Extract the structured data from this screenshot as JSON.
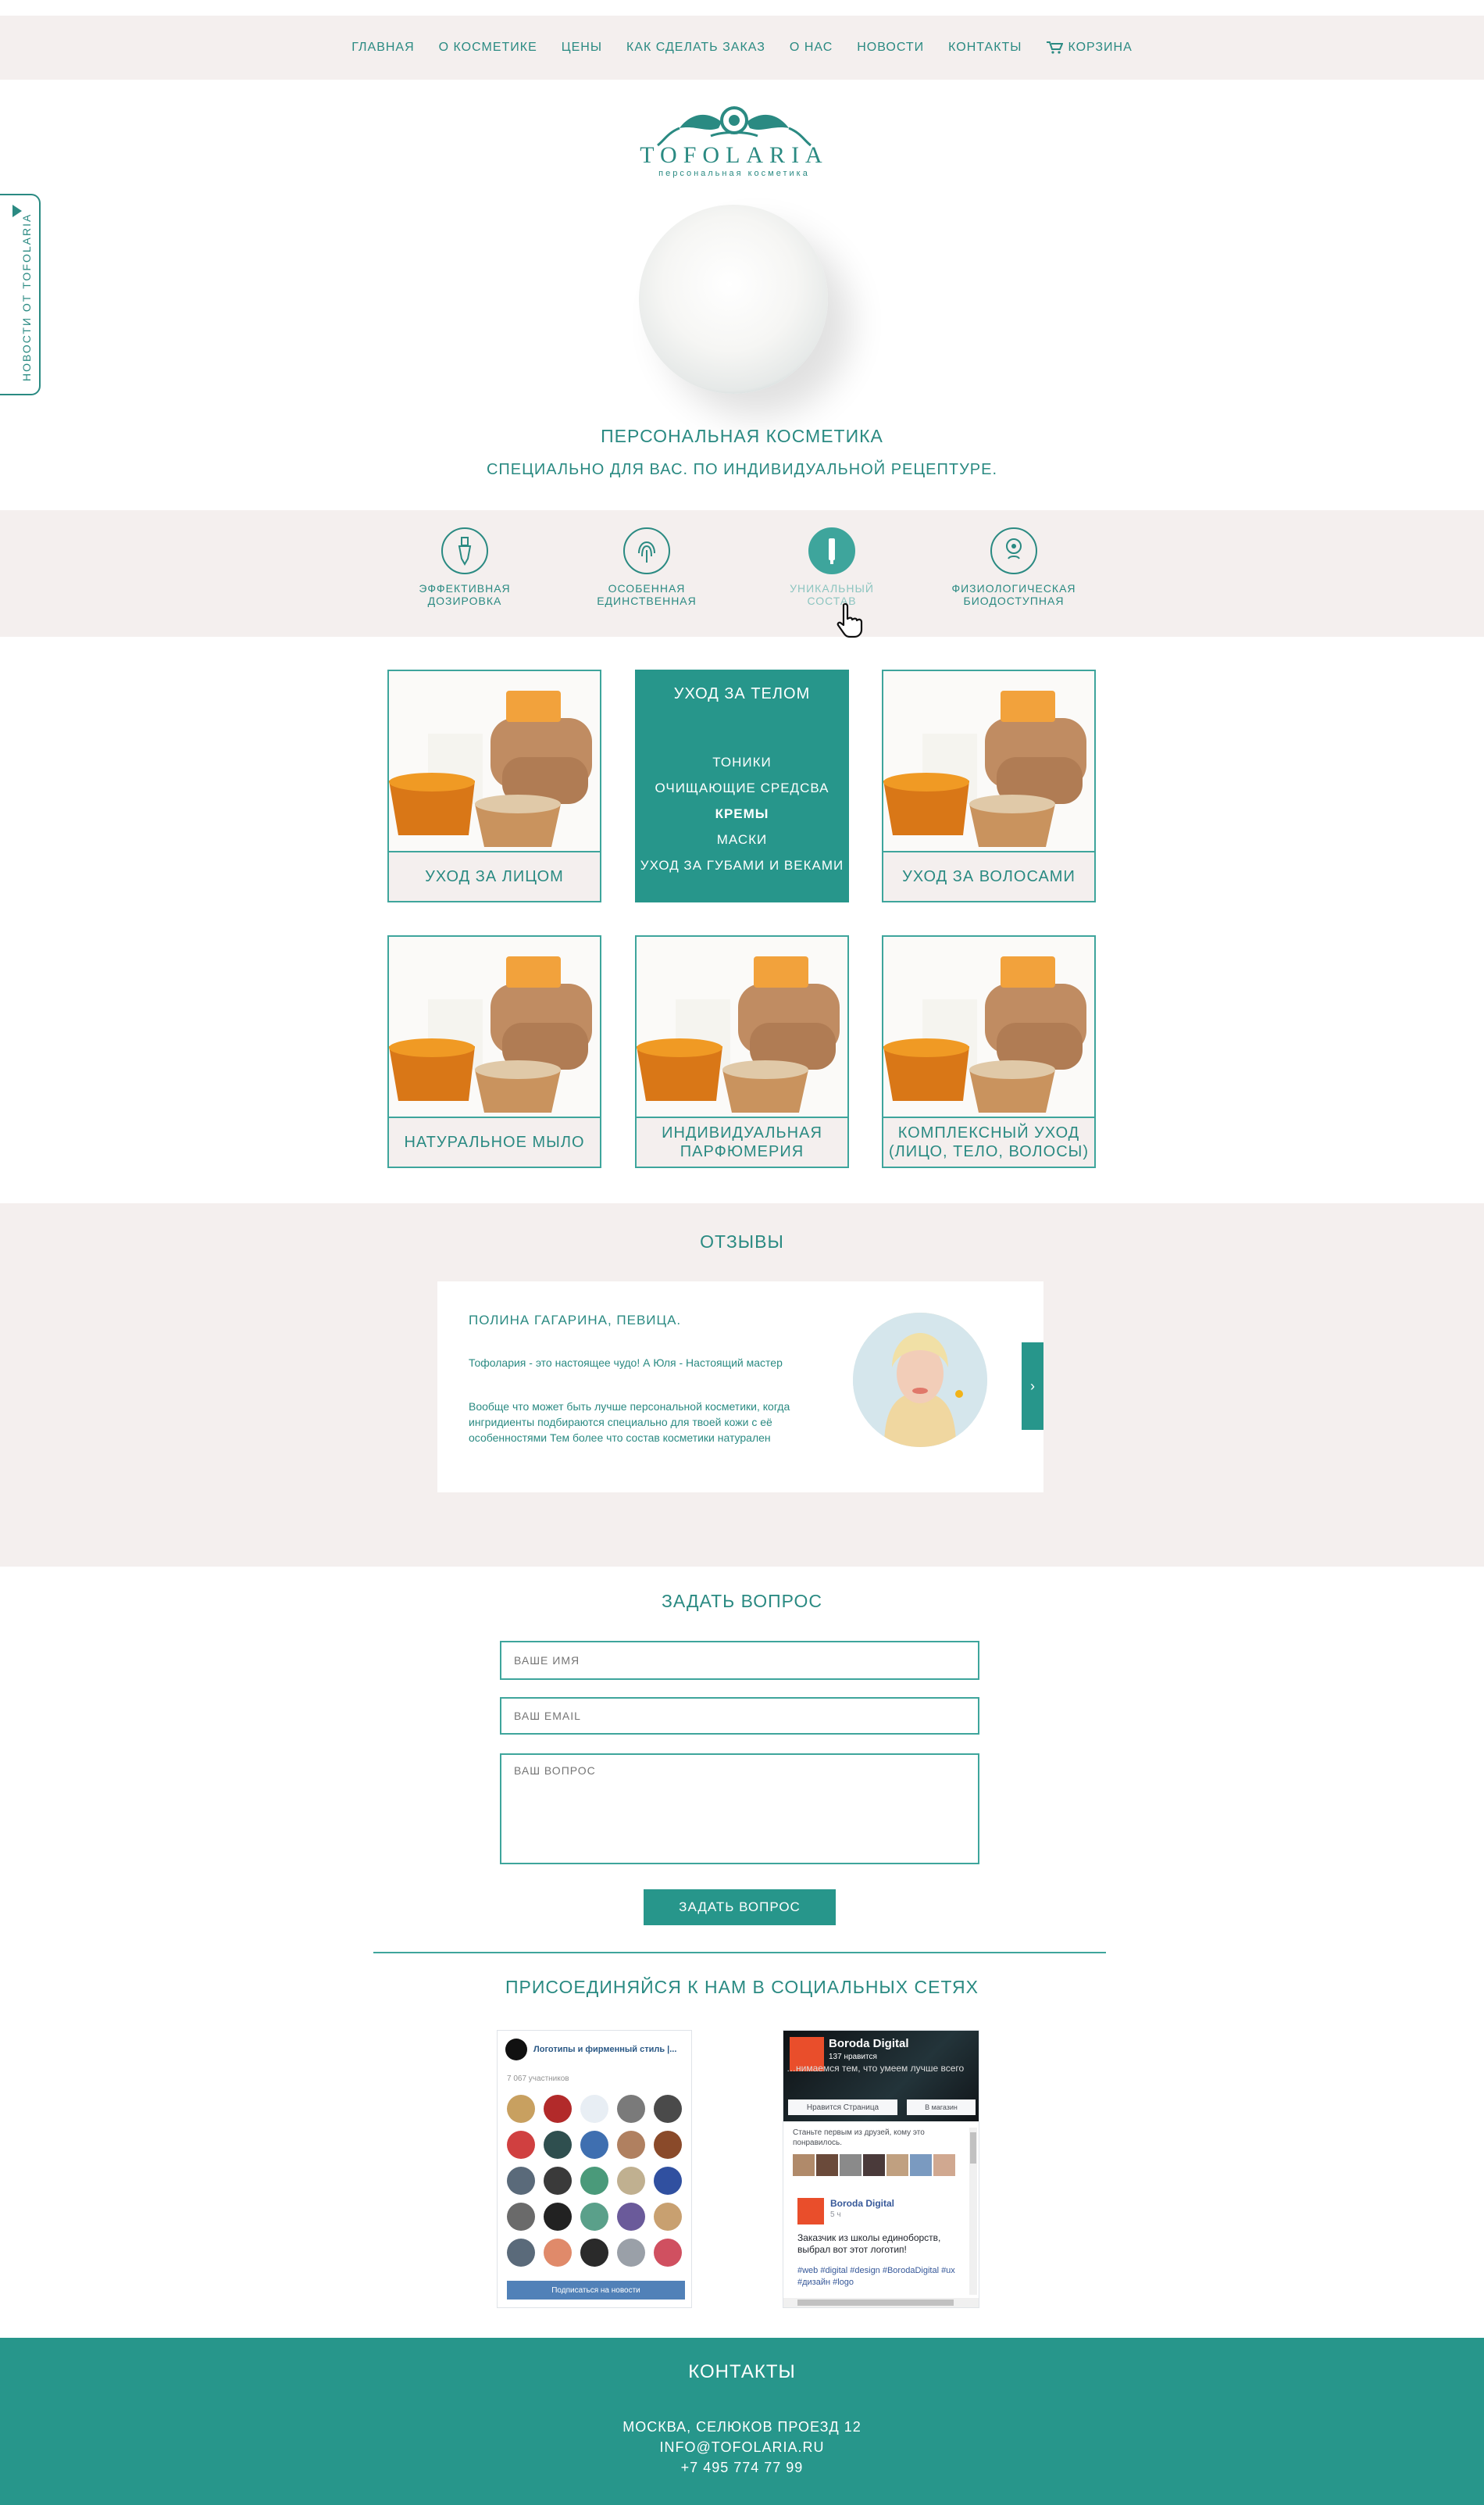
{
  "nav": {
    "items": [
      "ГЛАВНАЯ",
      "О КОСМЕТИКЕ",
      "ЦЕНЫ",
      "КАК СДЕЛАТЬ ЗАКАЗ",
      "О НАС",
      "НОВОСТИ",
      "КОНТАКТЫ"
    ],
    "cart": "КОРЗИНА"
  },
  "sidetab": "НОВОСТИ ОТ TOFOLARIA",
  "logo": {
    "brand": "TOFOLARIA",
    "tagline": "персональная косметика"
  },
  "hero": {
    "title": "ПЕРСОНАЛЬНАЯ КОСМЕТИКА",
    "subtitle": "СПЕЦИАЛЬНО ДЛЯ ВАС. ПО ИНДИВИДУАЛЬНОЙ РЕЦЕПТУРЕ."
  },
  "features": [
    {
      "line1": "ЭФФЕКТИВНАЯ",
      "line2": "ДОЗИРОВКА",
      "icon": "dropper-icon"
    },
    {
      "line1": "ОСОБЕННАЯ",
      "line2": "ЕДИНСТВЕННАЯ",
      "icon": "fingerprint-icon"
    },
    {
      "line1": "УНИКАЛЬНЫЙ",
      "line2": "СОСТАВ",
      "icon": "tube-icon"
    },
    {
      "line1": "ФИЗИОЛОГИЧЕСКАЯ",
      "line2": "БИОДОСТУПНАЯ",
      "icon": "head-icon"
    }
  ],
  "products": {
    "face": "УХОД ЗА ЛИЦОМ",
    "body": {
      "title": "УХОД ЗА ТЕЛОМ",
      "items": [
        "ТОНИКИ",
        "ОЧИЩАЮЩИЕ СРЕДСВА",
        "КРЕМЫ",
        "МАСКИ",
        "УХОД ЗА ГУБАМИ И ВЕКАМИ"
      ]
    },
    "hair": "УХОД ЗА ВОЛОСАМИ",
    "soap": "НАТУРАЛЬНОЕ МЫЛО",
    "perfume_line1": "ИНДИВИДУАЛЬНАЯ",
    "perfume_line2": "ПАРФЮМЕРИЯ",
    "complex_line1": "КОМПЛЕКСНЫЙ УХОД",
    "complex_line2": "(ЛИЦО, ТЕЛО, ВОЛОСЫ)"
  },
  "reviews": {
    "title": "ОТЗЫВЫ",
    "name": "ПОЛИНА ГАГАРИНА, ПЕВИЦА.",
    "quote": "Тофолария - это настоящее чудо! А Юля - Настоящий мастер",
    "text": "Вообще что может быть лучше персональной косметики, когда ингридиенты подбираются специально для твоей кожи с её особенностями Тем более что состав косметики натурален",
    "prev": "‹",
    "next": "›"
  },
  "ask": {
    "title": "ЗАДАТЬ ВОПРОС",
    "name_placeholder": "ВАШЕ ИМЯ",
    "email_placeholder": "ВАШ EMAIL",
    "question_placeholder": "ВАШ ВОПРОС",
    "submit": "ЗАДАТЬ ВОПРОС"
  },
  "social": {
    "title": "ПРИСОЕДИНЯЙСЯ К НАМ В СОЦИАЛЬНЫХ СЕТЯХ",
    "vk": {
      "group": "Логотипы и фирменный стиль |...",
      "members": "7 067 участников",
      "subscribe": "Подписаться на новости"
    },
    "fb": {
      "page": "Boroda Digital",
      "likes": "137 нравится",
      "slogan": "…нимаемся тем, что умеем лучше всего",
      "like_btn": "Нравится Страница",
      "share_btn": "В магазин",
      "friends": "Станьте первым из друзей, кому это понравилось.",
      "post_name": "Boroda Digital",
      "post_time": "5 ч",
      "post_text": "Заказчик из школы единоборств, выбрал вот этот логотип!",
      "post_tags": "#web #digital #design #BorodaDigital #ux #дизайн #logo"
    }
  },
  "footer": {
    "title": "КОНТАКТЫ",
    "address": "МОСКВА, СЕЛЮКОВ ПРОЕЗД 12",
    "email": "INFO@TOFOLARIA.RU",
    "phone": "+7 495 774 77 99"
  },
  "colors": {
    "accent": "#27968b",
    "text": "#2a8a82",
    "band": "#f4efee"
  }
}
